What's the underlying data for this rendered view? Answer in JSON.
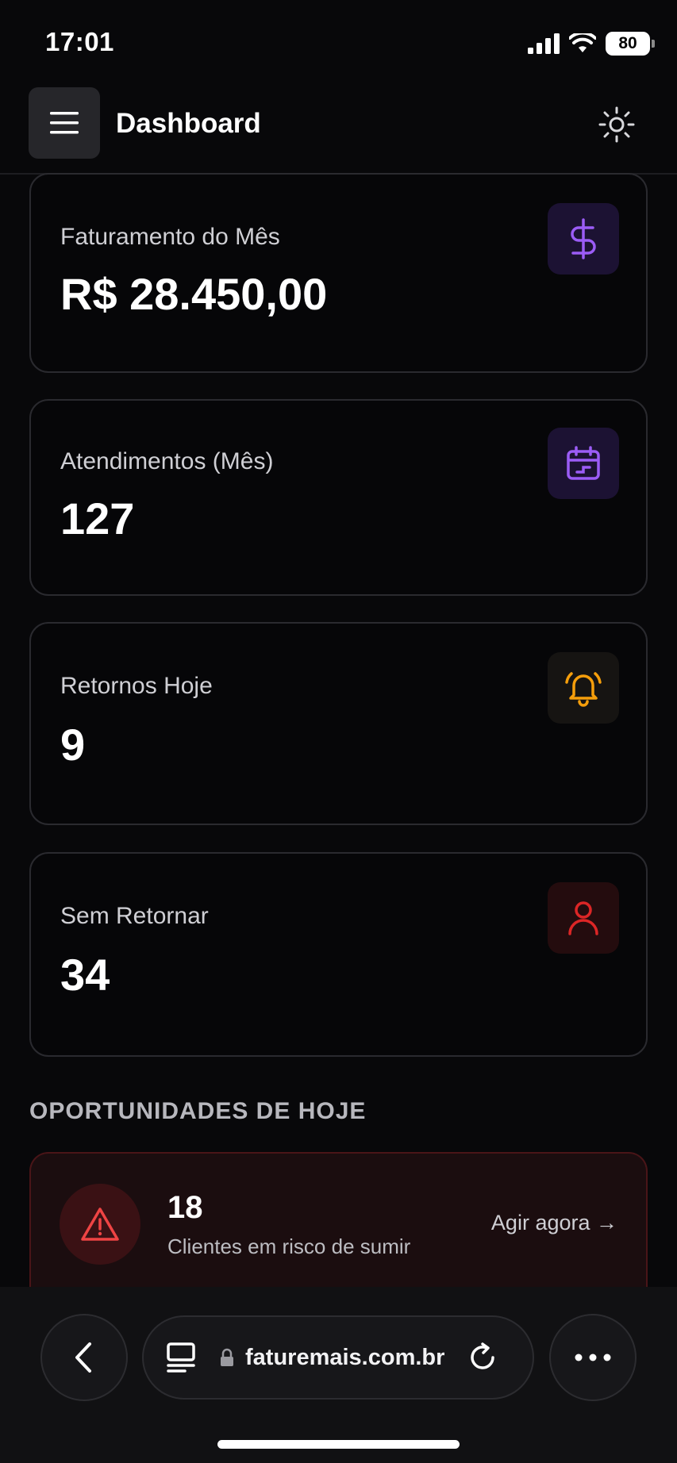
{
  "status": {
    "time": "17:01",
    "battery": "80"
  },
  "header": {
    "title": "Dashboard"
  },
  "cards": [
    {
      "label": "Faturamento do Mês",
      "value": "R$ 28.450,00",
      "icon": "dollar-icon",
      "accent": "#9b5cf6"
    },
    {
      "label": "Atendimentos (Mês)",
      "value": "127",
      "icon": "calendar-icon",
      "accent": "#9b5cf6"
    },
    {
      "label": "Retornos Hoje",
      "value": "9",
      "icon": "bell-icon",
      "accent": "#f59e0b"
    },
    {
      "label": "Sem Retornar",
      "value": "34",
      "icon": "user-icon",
      "accent": "#dc2626"
    }
  ],
  "opportunities": {
    "title": "OPORTUNIDADES DE HOJE",
    "alert": {
      "count": "18",
      "description": "Clientes em risco de sumir",
      "action": "Agir agora →",
      "icon": "warning-icon",
      "accent": "#ef4444"
    }
  },
  "browser": {
    "url": "faturemais.com.br"
  }
}
